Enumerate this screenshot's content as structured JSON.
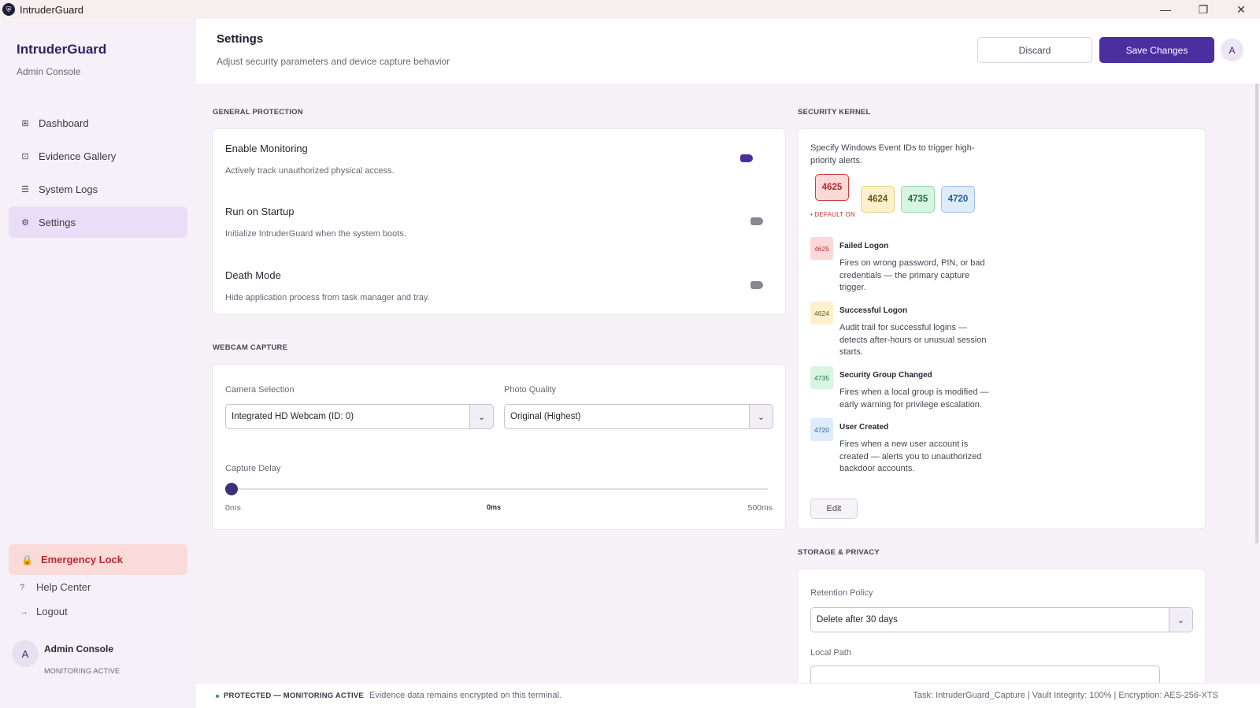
{
  "window": {
    "title": "IntruderGuard",
    "controls": {
      "minimize": "—",
      "restore": "❐",
      "close": "✕"
    }
  },
  "sidebar": {
    "brand": "IntruderGuard",
    "subtitle": "Admin Console",
    "nav": [
      {
        "label": "Dashboard",
        "icon": "grid-icon",
        "glyph": "⊞"
      },
      {
        "label": "Evidence Gallery",
        "icon": "gallery-icon",
        "glyph": "⊡"
      },
      {
        "label": "System Logs",
        "icon": "list-icon",
        "glyph": "☰"
      },
      {
        "label": "Settings",
        "icon": "gear-icon",
        "glyph": "⚙"
      }
    ],
    "active_item": "Settings",
    "emergency": {
      "label": "Emergency Lock",
      "icon": "lock-icon",
      "glyph": "🔒"
    },
    "help": {
      "label": "Help Center",
      "glyph": "?"
    },
    "logout": {
      "label": "Logout",
      "glyph": "→"
    },
    "user": {
      "initial": "A",
      "name": "Admin Console",
      "status": "MONITORING ACTIVE"
    }
  },
  "header": {
    "title": "Settings",
    "subtitle": "Adjust security parameters and device capture behavior",
    "discard_label": "Discard",
    "save_label": "Save Changes",
    "avatar_initial": "A"
  },
  "general": {
    "section_label": "GENERAL PROTECTION",
    "rows": [
      {
        "title": "Enable Monitoring",
        "desc": "Actively track unauthorized physical access.",
        "enabled": true
      },
      {
        "title": "Run on Startup",
        "desc": "Initialize IntruderGuard when the system boots.",
        "enabled": false
      },
      {
        "title": "Death Mode",
        "desc": "Hide application process from task manager and tray.",
        "enabled": false
      }
    ]
  },
  "webcam": {
    "section_label": "WEBCAM CAPTURE",
    "camera_label": "Camera Selection",
    "camera_value": "Integrated HD Webcam (ID: 0)",
    "quality_label": "Photo Quality",
    "quality_value": "Original (Highest)",
    "delay_label": "Capture Delay",
    "delay_min": "0ms",
    "delay_current": "0ms",
    "delay_max": "500ms",
    "delay_value_fraction": 0
  },
  "kernel": {
    "section_label": "SECURITY KERNEL",
    "description": "Specify Windows Event IDs to trigger high-priority alerts.",
    "chips": [
      {
        "id": "4625",
        "bg": "#fcd9d9",
        "fg": "#b42b2b",
        "border": "#d23b3b"
      },
      {
        "id": "4624",
        "bg": "#fdf0cc",
        "fg": "#6b5418",
        "border": "#e6cf86"
      },
      {
        "id": "4735",
        "bg": "#d8f5e2",
        "fg": "#24724a",
        "border": "#94d8ae"
      },
      {
        "id": "4720",
        "bg": "#dcecfb",
        "fg": "#2b5c8f",
        "border": "#98c2ea"
      }
    ],
    "default_note": "• DEFAULT ON",
    "events": [
      {
        "id": "4625",
        "name": "Failed Logon",
        "desc": "Fires on wrong password, PIN, or bad credentials — the primary capture trigger."
      },
      {
        "id": "4624",
        "name": "Successful Logon",
        "desc": "Audit trail for successful logins — detects after-hours or unusual session starts."
      },
      {
        "id": "4735",
        "name": "Security Group Changed",
        "desc": "Fires when a local group is modified — early warning for privilege escalation."
      },
      {
        "id": "4720",
        "name": "User Created",
        "desc": "Fires when a new user account is created — alerts you to unauthorized backdoor accounts."
      }
    ],
    "edit_label": "Edit"
  },
  "storage": {
    "section_label": "STORAGE & PRIVACY",
    "retention_label": "Retention Policy",
    "retention_value": "Delete after 30 days",
    "path_label": "Local Path"
  },
  "footer": {
    "status": "PROTECTED — MONITORING ACTIVE",
    "note": "Evidence data remains encrypted on this terminal.",
    "meta": "Task: IntruderGuard_Capture | Vault Integrity: 100% | Encryption: AES-256-XTS"
  }
}
